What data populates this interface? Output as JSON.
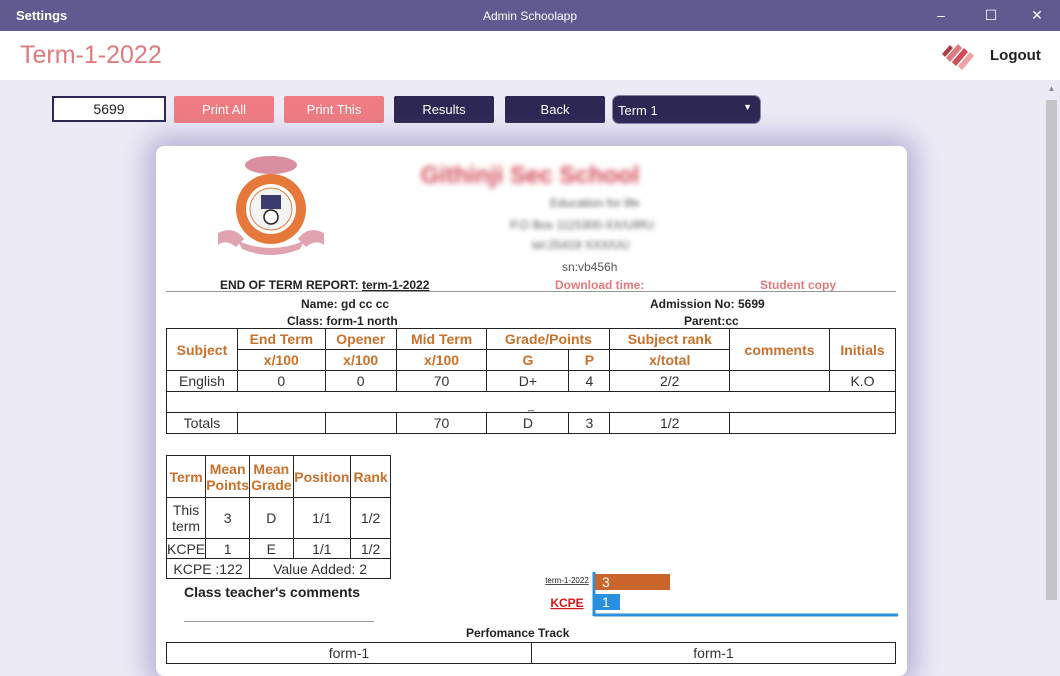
{
  "window": {
    "left_title": "Settings",
    "app_title": "Admin Schoolapp",
    "minimize": "–",
    "maximize": "☐",
    "close": "✕"
  },
  "header": {
    "page_title": "Term-1-2022",
    "logout_label": "Logout"
  },
  "toolbar": {
    "admission_value": "5699",
    "print_all_label": "Print All",
    "print_this_label": "Print This",
    "results_label": "Results",
    "back_label": "Back",
    "term_selected": "Term 1",
    "term_arrow": "▼"
  },
  "report": {
    "school_name": "Githinji Sec School",
    "address_line1": "Education for life",
    "address_line2": "P.O Box 1115300-XX/UIRU",
    "address_line3": "tel:25419 XXX/UU",
    "serial": "sn:vb456h",
    "report_title_prefix": "END OF TERM REPORT: ",
    "report_title_term": "term-1-2022",
    "download_time_label": "Download time:",
    "student_copy_label": "Student copy",
    "name_line": "Name: gd cc cc",
    "class_line": "Class: form-1 north",
    "admission_line": "Admission No: 5699",
    "parent_line": "Parent:cc"
  },
  "subjects_table": {
    "headers_top": [
      "Subject",
      "End Term",
      "Opener",
      "Mid Term",
      "Grade/Points",
      "Subject rank",
      "comments",
      "Initials"
    ],
    "headers_sub": [
      "x/100",
      "x/100",
      "x/100",
      "G",
      "P",
      "x/total"
    ],
    "rows": [
      {
        "subject": "English",
        "end_term": "0",
        "opener": "0",
        "mid_term": "70",
        "grade": "D+",
        "points": "4",
        "rank": "2/2",
        "comments": "",
        "initials": "K.O"
      }
    ],
    "spacer_text": "_",
    "totals": {
      "label": "Totals",
      "end_term": "",
      "opener": "",
      "mid_term": "70",
      "grade": "D",
      "points": "3",
      "rank": "1/2",
      "comments": ""
    }
  },
  "summary_table": {
    "headers": [
      "Term",
      "Mean Points",
      "Mean Grade",
      "Position",
      "Rank"
    ],
    "rows": [
      {
        "term": "This term",
        "mean_points": "3",
        "mean_grade": "D",
        "position": "1/1",
        "rank": "1/2"
      },
      {
        "term": "KCPE",
        "mean_points": "1",
        "mean_grade": "E",
        "position": "1/1",
        "rank": "1/2"
      }
    ],
    "kcpe_label": "KCPE :122",
    "value_added_label": "Value Added: 2"
  },
  "class_teacher_label": "Class teacher's comments",
  "chart_data": {
    "type": "bar",
    "orientation": "horizontal",
    "categories": [
      "term-1-2022",
      "KCPE"
    ],
    "values": [
      3,
      1
    ],
    "colors": [
      "#c9652a",
      "#2b8fe0"
    ],
    "value_labels": [
      "3",
      "1"
    ],
    "xlim": [
      0,
      12
    ]
  },
  "performance_track": {
    "title": "Perfomance Track",
    "columns": [
      "form-1",
      "form-1"
    ]
  }
}
